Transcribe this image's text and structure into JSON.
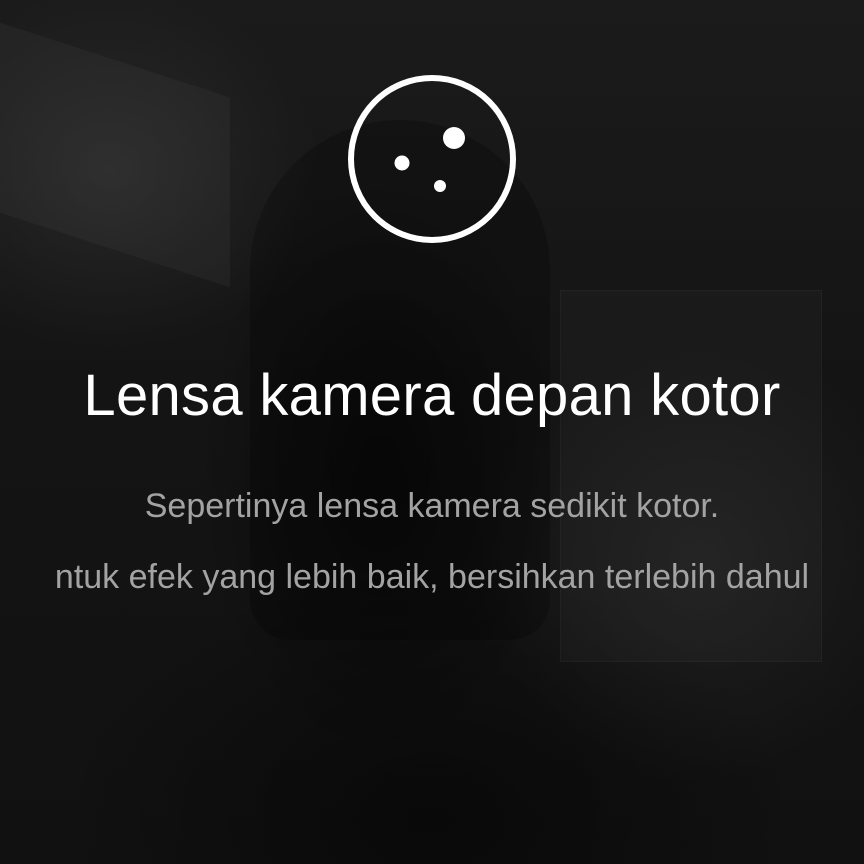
{
  "dialog": {
    "icon": "dirty-lens-icon",
    "title": "Lensa kamera depan kotor",
    "message_line1": "Sepertinya lensa kamera sedikit kotor.",
    "message_line2": "ntuk efek yang lebih baik, bersihkan terlebih dahul"
  },
  "colors": {
    "background": "#141414",
    "title": "#ffffff",
    "message": "#a3a3a3",
    "icon": "#ffffff"
  }
}
